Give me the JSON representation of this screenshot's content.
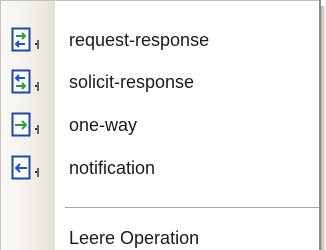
{
  "menu": {
    "items": [
      {
        "label": "request-response",
        "icon": "request-response-icon"
      },
      {
        "label": "solicit-response",
        "icon": "solicit-response-icon"
      },
      {
        "label": "one-way",
        "icon": "one-way-icon"
      },
      {
        "label": "notification",
        "icon": "notification-icon"
      }
    ],
    "footer_item": {
      "label": "Leere Operation"
    }
  },
  "colors": {
    "icon_frame": "#1f45b5",
    "arrow_green": "#27a23a",
    "arrow_blue": "#1c4fd1",
    "gutter": "#ece9e0"
  }
}
